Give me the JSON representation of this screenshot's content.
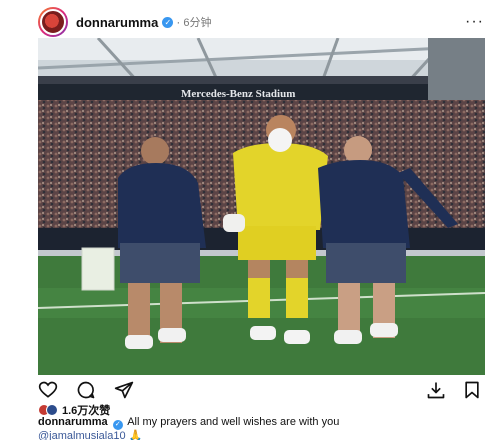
{
  "post": {
    "username": "donnarumma",
    "separator": "·",
    "time": "6分钟",
    "more": "···",
    "stadium_sign": "Mercedes-Benz Stadium",
    "likes": "1.6万次赞",
    "caption": {
      "username": "donnarumma",
      "text": "All my prayers and well wishes are with you",
      "mention": "@jamalmusiala10",
      "emoji": "🙏"
    }
  },
  "icons": [
    "heart-icon",
    "comment-icon",
    "share-icon",
    "download-icon",
    "bookmark-icon",
    "verified-icon",
    "more-icon"
  ]
}
